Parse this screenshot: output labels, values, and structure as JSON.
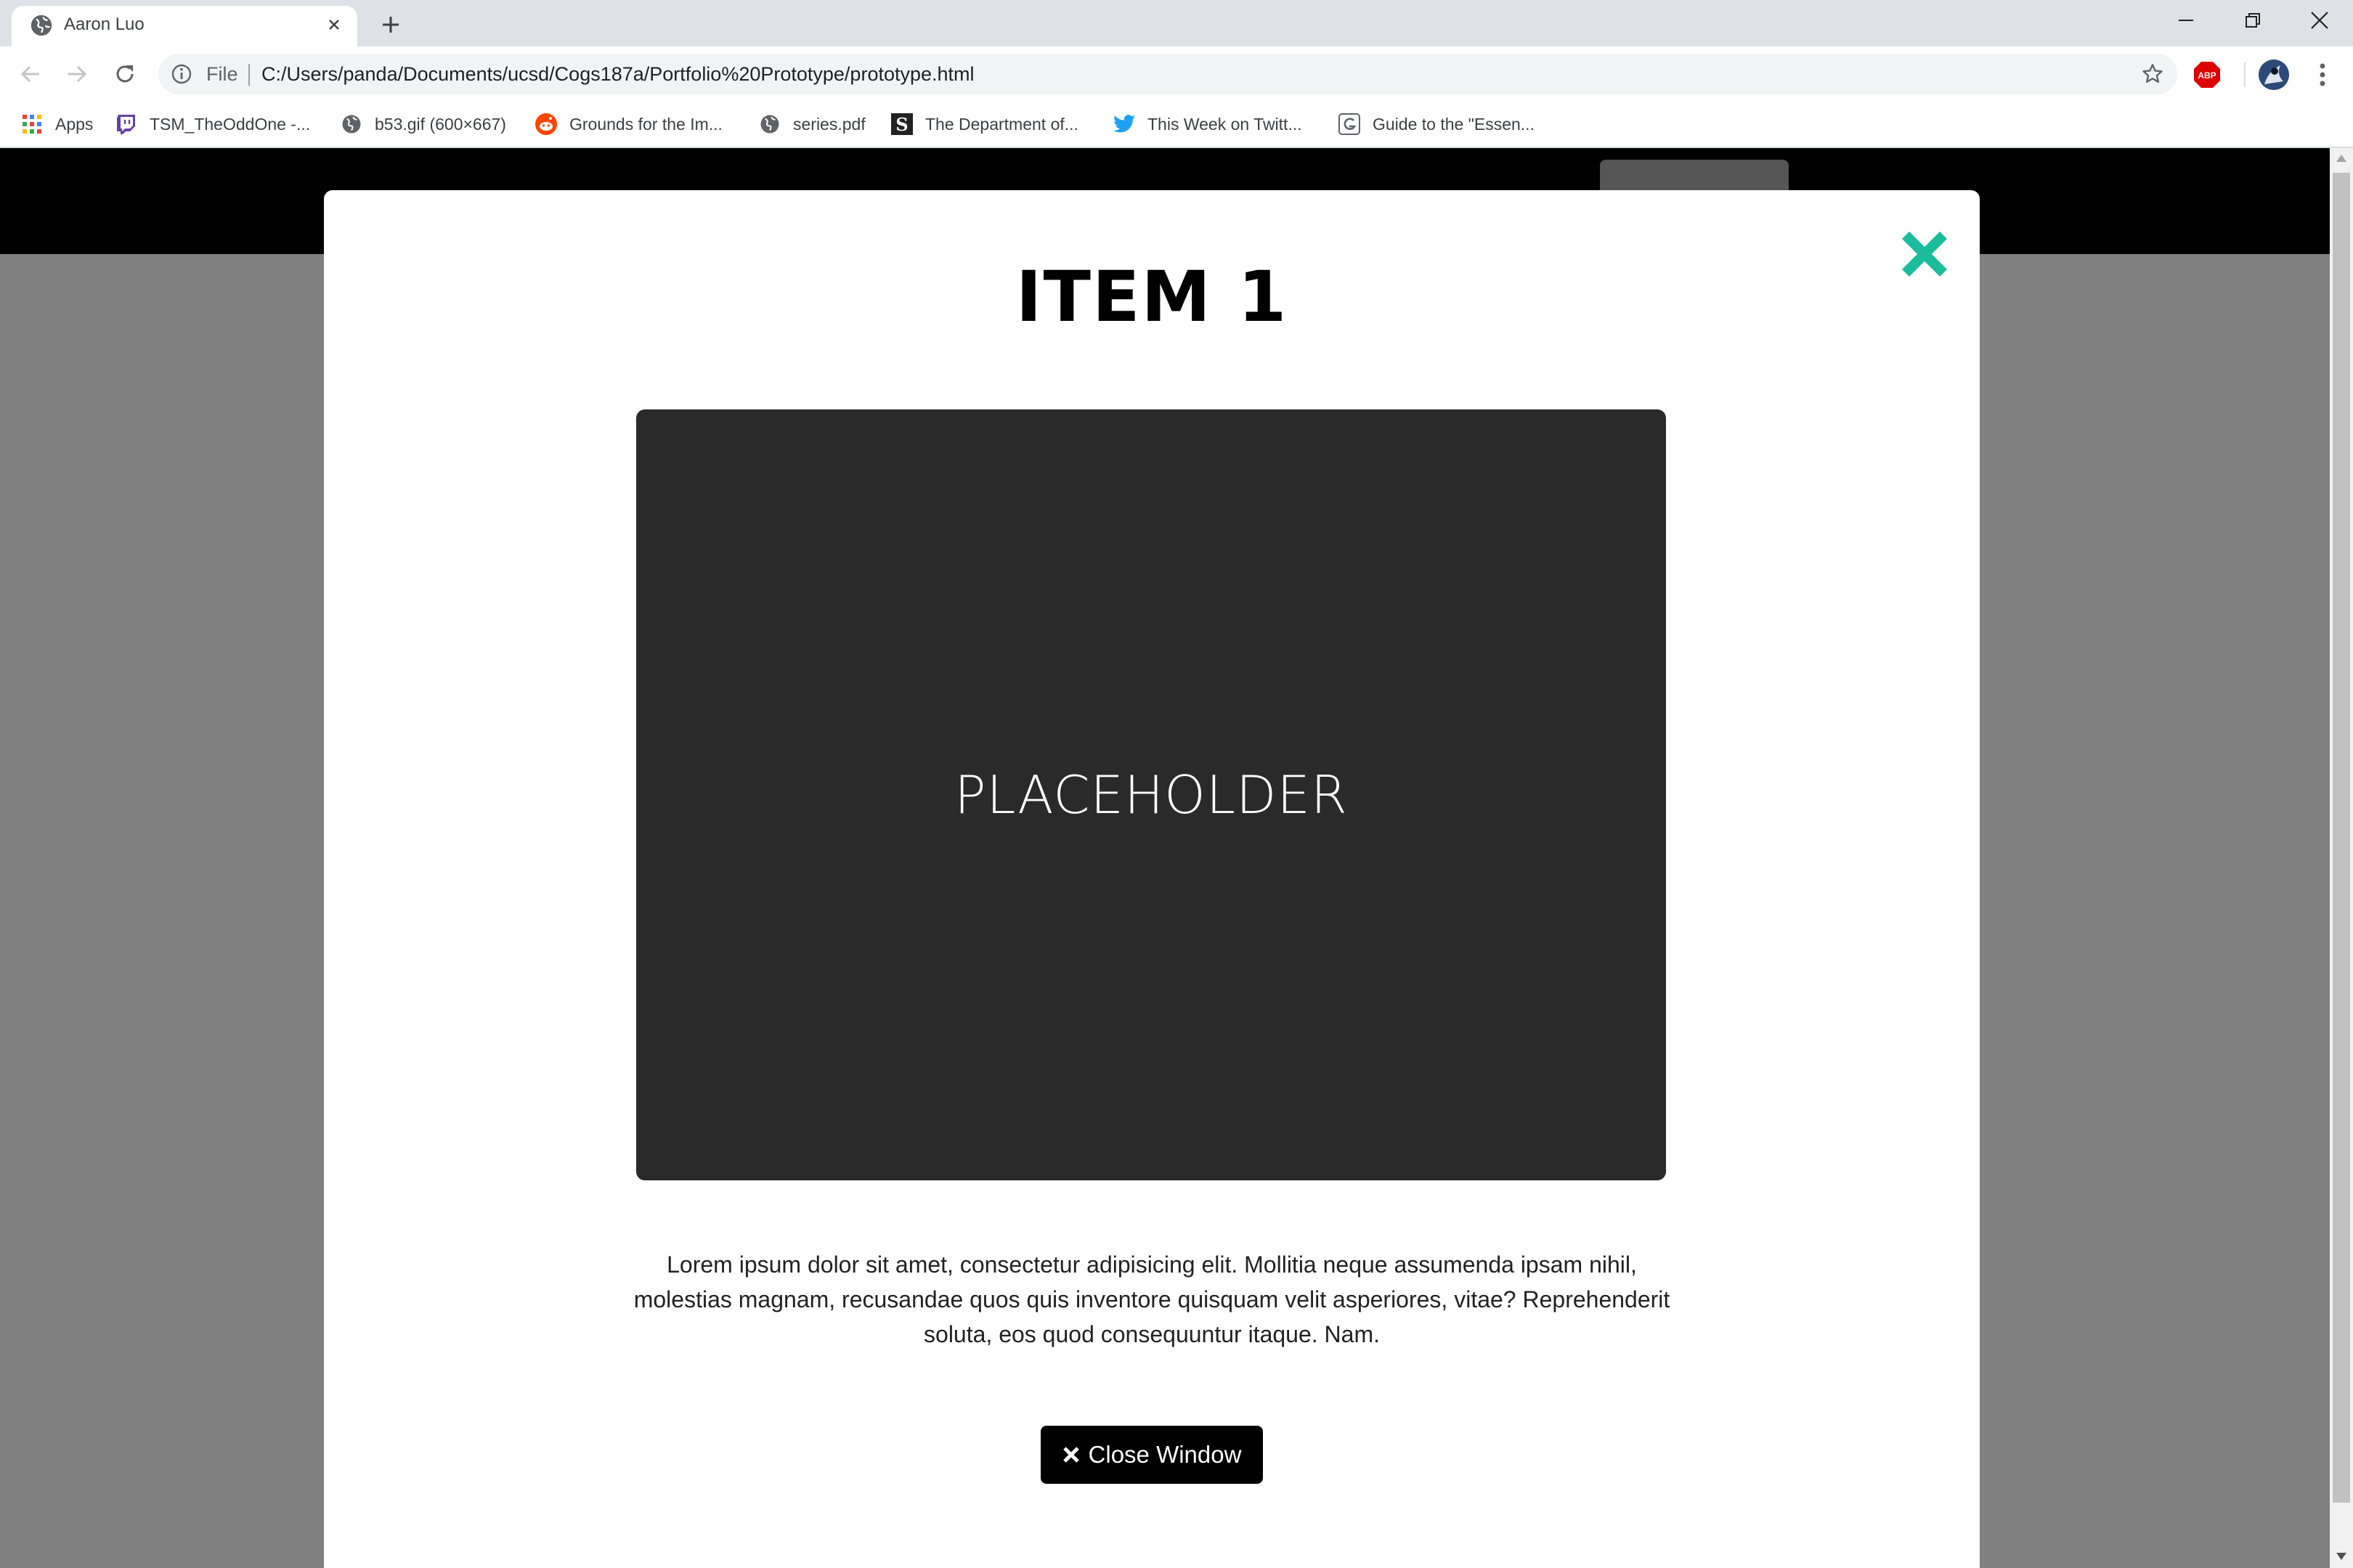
{
  "browser": {
    "tab_title": "Aaron Luo",
    "url_scheme": "File",
    "url": "C:/Users/panda/Documents/ucsd/Cogs187a/Portfolio%20Prototype/prototype.html",
    "extension_label": "ABP",
    "bookmarks": [
      {
        "label": "Apps",
        "icon": "apps-grid-icon"
      },
      {
        "label": "TSM_TheOddOne -...",
        "icon": "twitch-icon"
      },
      {
        "label": "b53.gif (600×667)",
        "icon": "globe-icon"
      },
      {
        "label": "Grounds for the Im...",
        "icon": "reddit-icon"
      },
      {
        "label": "series.pdf",
        "icon": "globe-icon"
      },
      {
        "label": "The Department of...",
        "icon": "s-logo-icon"
      },
      {
        "label": "This Week on Twitt...",
        "icon": "twitter-icon"
      },
      {
        "label": "Guide to the \"Essen...",
        "icon": "bookmark-site-icon"
      }
    ]
  },
  "modal": {
    "title": "ITEM 1",
    "image_placeholder": "PLACEHOLDER",
    "description": "Lorem ipsum dolor sit amet, consectetur adipisicing elit. Mollitia neque assumenda ipsam nihil, molestias magnam, recusandae quos quis inventore quisquam velit asperiores, vitae? Reprehenderit soluta, eos quod consequuntur itaque. Nam.",
    "close_button_label": "Close Window",
    "accent_color": "#1abc9c"
  }
}
